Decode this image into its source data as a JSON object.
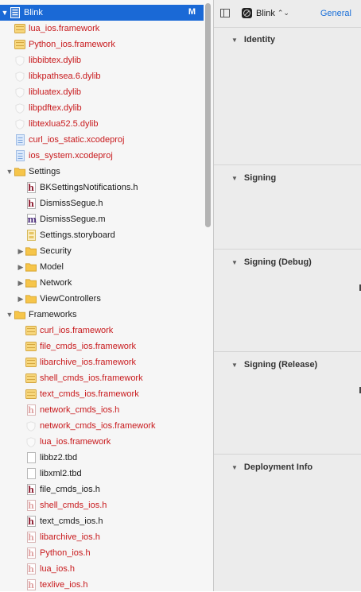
{
  "navigator": {
    "project": {
      "label": "Blink",
      "badge": "M"
    },
    "items": [
      {
        "label": "lua_ios.framework",
        "kind": "framework",
        "red": true
      },
      {
        "label": "Python_ios.framework",
        "kind": "framework",
        "red": true
      },
      {
        "label": "libbibtex.dylib",
        "kind": "dylib",
        "red": true
      },
      {
        "label": "libkpathsea.6.dylib",
        "kind": "dylib",
        "red": true
      },
      {
        "label": "libluatex.dylib",
        "kind": "dylib",
        "red": true
      },
      {
        "label": "libpdftex.dylib",
        "kind": "dylib",
        "red": true
      },
      {
        "label": "libtexlua52.5.dylib",
        "kind": "dylib",
        "red": true
      },
      {
        "label": "curl_ios_static.xcodeproj",
        "kind": "xcodeproj",
        "red": true
      },
      {
        "label": "ios_system.xcodeproj",
        "kind": "xcodeproj",
        "red": true
      },
      {
        "label": "Settings",
        "kind": "folder",
        "red": false
      },
      {
        "label": "BKSettingsNotifications.h",
        "kind": "h",
        "red": false
      },
      {
        "label": "DismissSegue.h",
        "kind": "h",
        "red": false
      },
      {
        "label": "DismissSegue.m",
        "kind": "m",
        "red": false
      },
      {
        "label": "Settings.storyboard",
        "kind": "storyboard",
        "red": false
      },
      {
        "label": "Security",
        "kind": "folder",
        "red": false
      },
      {
        "label": "Model",
        "kind": "folder",
        "red": false
      },
      {
        "label": "Network",
        "kind": "folder",
        "red": false
      },
      {
        "label": "ViewControllers",
        "kind": "folder",
        "red": false
      },
      {
        "label": "Frameworks",
        "kind": "folder",
        "red": false
      },
      {
        "label": "curl_ios.framework",
        "kind": "framework",
        "red": true
      },
      {
        "label": "file_cmds_ios.framework",
        "kind": "framework",
        "red": true
      },
      {
        "label": "libarchive_ios.framework",
        "kind": "framework",
        "red": true
      },
      {
        "label": "shell_cmds_ios.framework",
        "kind": "framework",
        "red": true
      },
      {
        "label": "text_cmds_ios.framework",
        "kind": "framework",
        "red": true
      },
      {
        "label": "network_cmds_ios.h",
        "kind": "h",
        "red": true
      },
      {
        "label": "network_cmds_ios.framework",
        "kind": "dylib",
        "red": true
      },
      {
        "label": "lua_ios.framework",
        "kind": "dylib",
        "red": true
      },
      {
        "label": "libbz2.tbd",
        "kind": "tbd",
        "red": false
      },
      {
        "label": "libxml2.tbd",
        "kind": "tbd",
        "red": false
      },
      {
        "label": "file_cmds_ios.h",
        "kind": "h",
        "red": false
      },
      {
        "label": "shell_cmds_ios.h",
        "kind": "h",
        "red": true
      },
      {
        "label": "text_cmds_ios.h",
        "kind": "h",
        "red": false
      },
      {
        "label": "libarchive_ios.h",
        "kind": "h",
        "red": true
      },
      {
        "label": "Python_ios.h",
        "kind": "h",
        "red": true
      },
      {
        "label": "lua_ios.h",
        "kind": "h",
        "red": true
      },
      {
        "label": "texlive_ios.h",
        "kind": "h",
        "red": true
      }
    ]
  },
  "inspector": {
    "target_name": "Blink",
    "tab_label": "General",
    "sections": [
      {
        "title": "Identity"
      },
      {
        "title": "Signing"
      },
      {
        "title": "Signing (Debug)"
      },
      {
        "title": "Signing (Release)"
      },
      {
        "title": "Deployment Info"
      }
    ]
  },
  "colors": {
    "selection": "#1a69d6",
    "missing_file_red": "#c8191c",
    "accent_blue": "#1a6fd8",
    "folder_yellow": "#f6c54a"
  }
}
